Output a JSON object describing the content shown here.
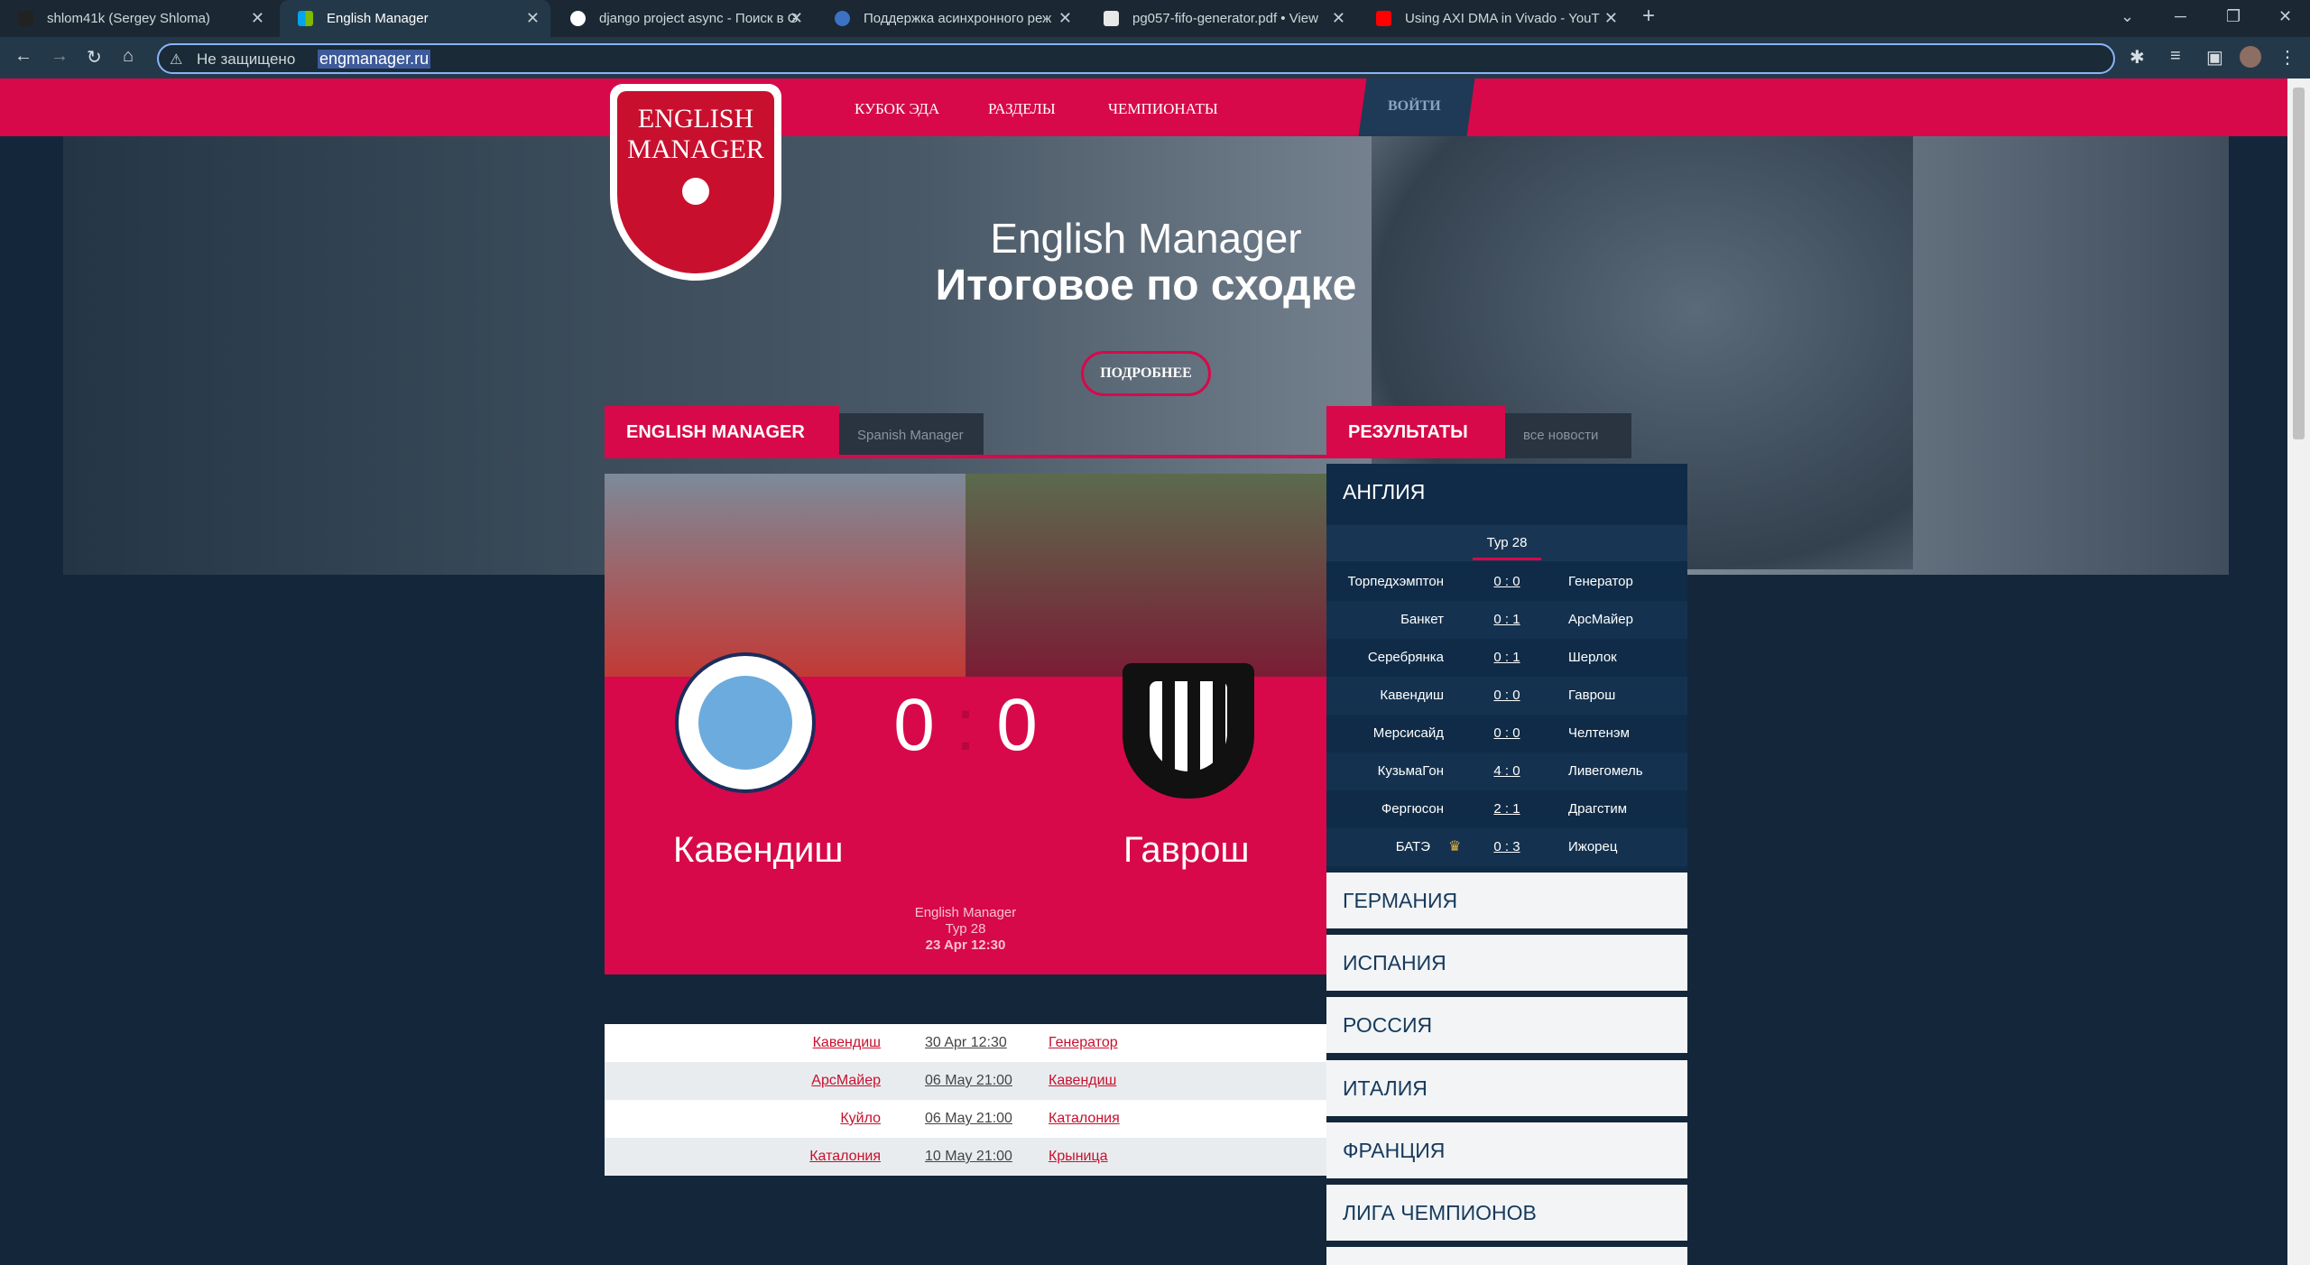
{
  "browser": {
    "tabs": [
      {
        "title": "shlom41k (Sergey Shloma)"
      },
      {
        "title": "English Manager"
      },
      {
        "title": "django project async - Поиск в G"
      },
      {
        "title": "Поддержка асинхронного реж"
      },
      {
        "title": "pg057-fifo-generator.pdf • View"
      },
      {
        "title": "Using AXI DMA in Vivado - YouT"
      }
    ],
    "insecure_label": "Не защищено",
    "url": "engmanager.ru",
    "colors": {
      "accent": "#d7094a",
      "bg": "#14273a"
    }
  },
  "nav": {
    "links": [
      "КУБОК ЭДА",
      "РАЗДЕЛЫ",
      "ЧЕМПИОНАТЫ"
    ],
    "login": "ВОЙТИ"
  },
  "logo": {
    "line1": "ENGLISH",
    "line2": "MANAGER"
  },
  "hero": {
    "title": "English Manager",
    "subtitle": "Итоговое по сходке",
    "button": "ПОДРОБНЕЕ"
  },
  "left_panel": {
    "tab_active": "ENGLISH MANAGER",
    "tab_other": "Spanish Manager"
  },
  "match": {
    "home": "Кавендиш",
    "away": "Гаврош",
    "home_score": "0",
    "away_score": "0",
    "competition": "English Manager",
    "round": "Тур 28",
    "datetime": "23 Apr 12:30"
  },
  "fixtures": [
    {
      "home": "Кавендиш",
      "date": "30 Apr 12:30",
      "away": "Генератор"
    },
    {
      "home": "АрсМайер",
      "date": "06 May 21:00",
      "away": "Кавендиш"
    },
    {
      "home": "Куйло",
      "date": "06 May 21:00",
      "away": "Каталония"
    },
    {
      "home": "Каталония",
      "date": "10 May 21:00",
      "away": "Крыница"
    }
  ],
  "right_panel": {
    "tab_active": "РЕЗУЛЬТАТЫ",
    "tab_other": "все новости",
    "country": "АНГЛИЯ",
    "round": "Тур 28",
    "results": [
      {
        "home": "Торпедхэмптон",
        "score": "0 : 0",
        "away": "Генератор"
      },
      {
        "home": "Банкет",
        "score": "0 : 1",
        "away": "АрсМайер"
      },
      {
        "home": "Серебрянка",
        "score": "0 : 1",
        "away": "Шерлок"
      },
      {
        "home": "Кавендиш",
        "score": "0 : 0",
        "away": "Гаврош"
      },
      {
        "home": "Мерсисайд",
        "score": "0 : 0",
        "away": "Челтенэм"
      },
      {
        "home": "КузьмаГон",
        "score": "4 : 0",
        "away": "Ливегомель"
      },
      {
        "home": "Фергюсон",
        "score": "2 : 1",
        "away": "Драгстим"
      },
      {
        "home": "БАТЭ",
        "score": "0 : 3",
        "away": "Ижорец"
      }
    ],
    "leagues": [
      "ГЕРМАНИЯ",
      "ИСПАНИЯ",
      "РОССИЯ",
      "ИТАЛИЯ",
      "ФРАНЦИЯ",
      "ЛИГА ЧЕМПИОНОВ"
    ]
  }
}
